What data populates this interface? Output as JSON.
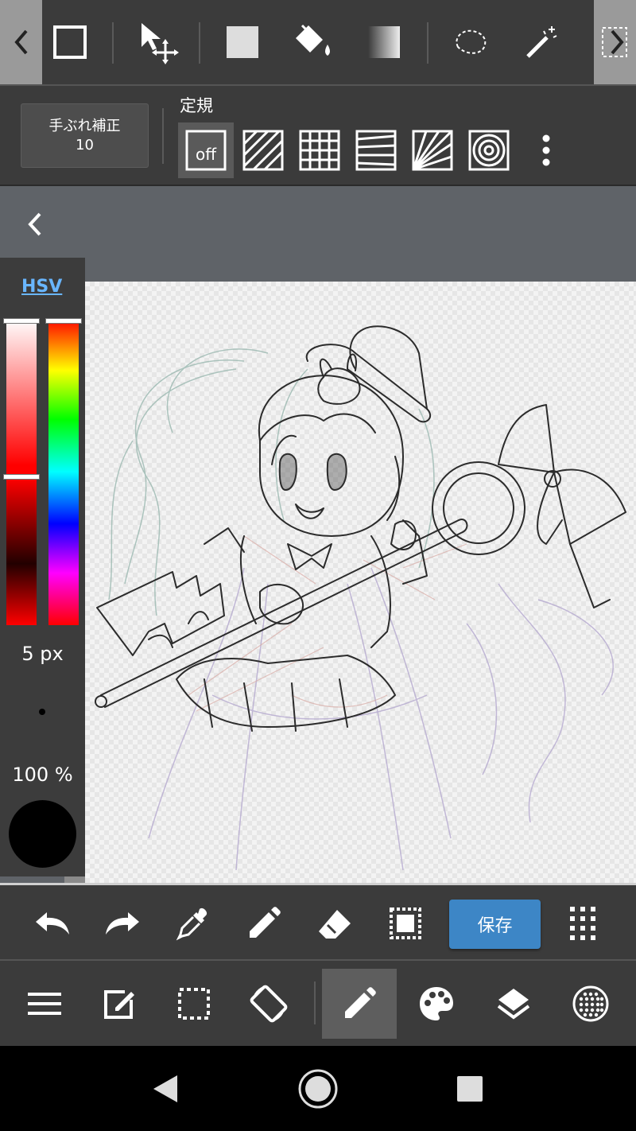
{
  "top_toolbar": {
    "tools": [
      {
        "name": "rectangle-tool"
      },
      {
        "name": "move-tool"
      },
      {
        "name": "fill-rect-tool"
      },
      {
        "name": "bucket-tool"
      },
      {
        "name": "gradient-tool"
      },
      {
        "name": "lasso-tool"
      },
      {
        "name": "magic-wand-tool"
      }
    ]
  },
  "options_bar": {
    "stabilizer": {
      "label": "手ぶれ補正",
      "value": "10"
    },
    "ruler_title": "定規",
    "ruler_off_label": "off"
  },
  "color_panel": {
    "mode_label": "HSV",
    "brush_size": "5 px",
    "opacity": "100 %",
    "current_color": "#000000"
  },
  "action_bar": {
    "save_label": "保存"
  },
  "colors": {
    "toolbar_bg": "#3b3b3b",
    "accent_blue": "#3d86c6",
    "link_blue": "#69b6ff",
    "canvas_area_bg": "#5f6368"
  }
}
